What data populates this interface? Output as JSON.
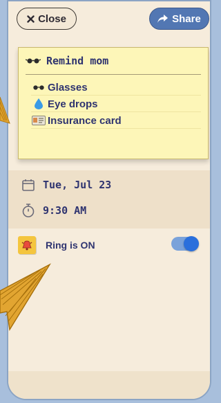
{
  "header": {
    "close_label": "Close",
    "share_label": "Share"
  },
  "note": {
    "title": "Remind mom",
    "title_icon": "glasses-icon",
    "items": [
      {
        "label": "Glasses",
        "icon": "glasses-icon"
      },
      {
        "label": "Eye drops",
        "icon": "droplet-icon"
      },
      {
        "label": "Insurance card",
        "icon": "id-card-icon"
      }
    ]
  },
  "schedule": {
    "date": "Tue, Jul 23",
    "time": "9:30 AM"
  },
  "ring": {
    "label": "Ring is ON",
    "enabled": true
  },
  "colors": {
    "accent": "#2a6fdc",
    "note_bg": "#fdf6b8",
    "card_bg": "#f6ecdc",
    "text": "#2f3470",
    "page_bg": "#a8bfdc"
  }
}
